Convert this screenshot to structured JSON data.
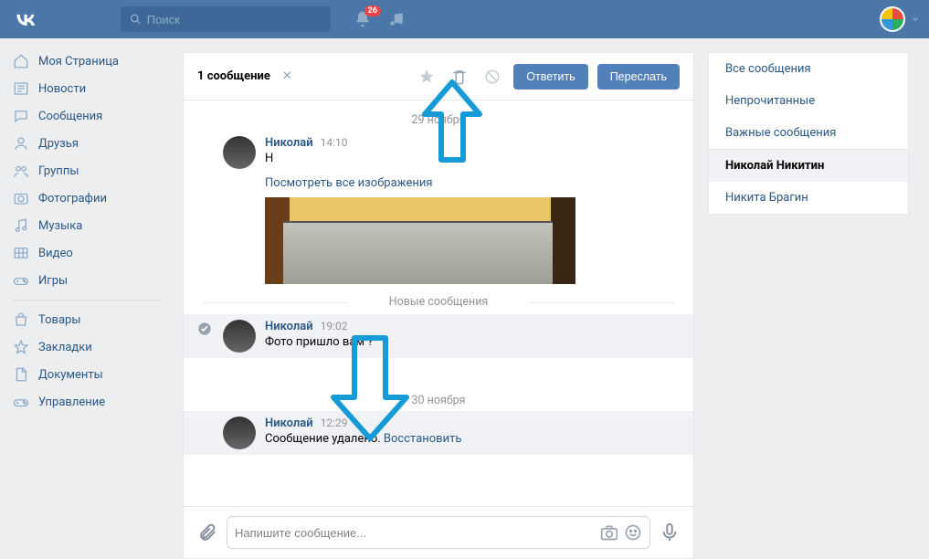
{
  "header": {
    "search_placeholder": "Поиск",
    "notif_badge": "26"
  },
  "sidebar": {
    "items": [
      {
        "label": "Моя Страница",
        "icon": "home"
      },
      {
        "label": "Новости",
        "icon": "news"
      },
      {
        "label": "Сообщения",
        "icon": "msg"
      },
      {
        "label": "Друзья",
        "icon": "friends"
      },
      {
        "label": "Группы",
        "icon": "groups"
      },
      {
        "label": "Фотографии",
        "icon": "photo"
      },
      {
        "label": "Музыка",
        "icon": "music"
      },
      {
        "label": "Видео",
        "icon": "video"
      },
      {
        "label": "Игры",
        "icon": "games"
      }
    ],
    "items2": [
      {
        "label": "Товары",
        "icon": "bag"
      },
      {
        "label": "Закладки",
        "icon": "star"
      },
      {
        "label": "Документы",
        "icon": "doc"
      },
      {
        "label": "Управление",
        "icon": "gamepad"
      }
    ]
  },
  "chat": {
    "selected_label": "1 сообщение",
    "reply_btn": "Ответить",
    "forward_btn": "Переслать",
    "date1": "29 ноября",
    "new_sep": "Новые сообщения",
    "date2": "30 ноября",
    "view_all_images": "Посмотреть все изображения",
    "msgs": [
      {
        "name": "Николай",
        "time": "14:10",
        "text": "Н"
      },
      {
        "name": "Николай",
        "time": "19:02",
        "text": "Фото пришло вам ?"
      },
      {
        "name": "Николай",
        "time": "12:29",
        "deleted": "Сообщение удалено.",
        "restore": "Восстановить"
      }
    ],
    "input_placeholder": "Напишите сообщение..."
  },
  "right": {
    "items": [
      {
        "label": "Все сообщения"
      },
      {
        "label": "Непрочитанные"
      },
      {
        "label": "Важные сообщения"
      }
    ],
    "convs": [
      {
        "label": "Николай Никитин",
        "active": true
      },
      {
        "label": "Никита Брагин"
      }
    ]
  }
}
